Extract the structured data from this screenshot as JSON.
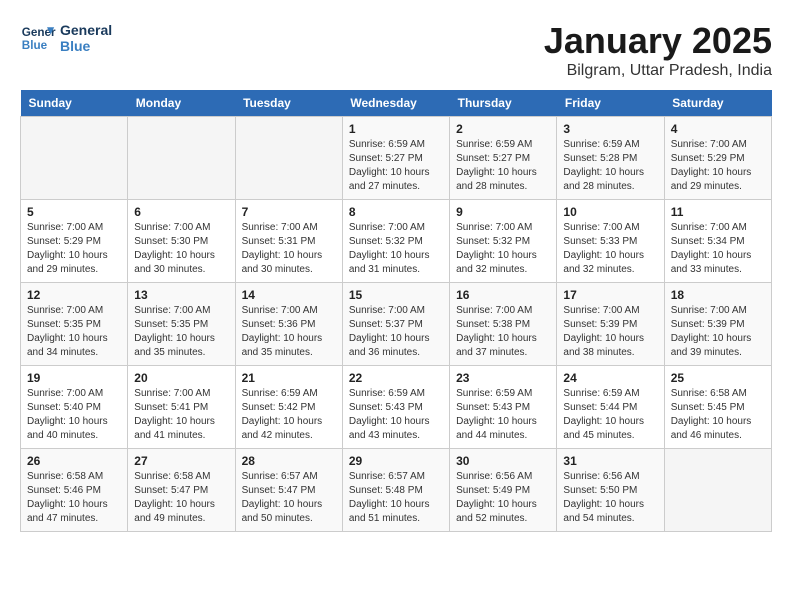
{
  "logo": {
    "line1": "General",
    "line2": "Blue"
  },
  "title": "January 2025",
  "subtitle": "Bilgram, Uttar Pradesh, India",
  "weekdays": [
    "Sunday",
    "Monday",
    "Tuesday",
    "Wednesday",
    "Thursday",
    "Friday",
    "Saturday"
  ],
  "weeks": [
    [
      {
        "day": "",
        "info": ""
      },
      {
        "day": "",
        "info": ""
      },
      {
        "day": "",
        "info": ""
      },
      {
        "day": "1",
        "info": "Sunrise: 6:59 AM\nSunset: 5:27 PM\nDaylight: 10 hours\nand 27 minutes."
      },
      {
        "day": "2",
        "info": "Sunrise: 6:59 AM\nSunset: 5:27 PM\nDaylight: 10 hours\nand 28 minutes."
      },
      {
        "day": "3",
        "info": "Sunrise: 6:59 AM\nSunset: 5:28 PM\nDaylight: 10 hours\nand 28 minutes."
      },
      {
        "day": "4",
        "info": "Sunrise: 7:00 AM\nSunset: 5:29 PM\nDaylight: 10 hours\nand 29 minutes."
      }
    ],
    [
      {
        "day": "5",
        "info": "Sunrise: 7:00 AM\nSunset: 5:29 PM\nDaylight: 10 hours\nand 29 minutes."
      },
      {
        "day": "6",
        "info": "Sunrise: 7:00 AM\nSunset: 5:30 PM\nDaylight: 10 hours\nand 30 minutes."
      },
      {
        "day": "7",
        "info": "Sunrise: 7:00 AM\nSunset: 5:31 PM\nDaylight: 10 hours\nand 30 minutes."
      },
      {
        "day": "8",
        "info": "Sunrise: 7:00 AM\nSunset: 5:32 PM\nDaylight: 10 hours\nand 31 minutes."
      },
      {
        "day": "9",
        "info": "Sunrise: 7:00 AM\nSunset: 5:32 PM\nDaylight: 10 hours\nand 32 minutes."
      },
      {
        "day": "10",
        "info": "Sunrise: 7:00 AM\nSunset: 5:33 PM\nDaylight: 10 hours\nand 32 minutes."
      },
      {
        "day": "11",
        "info": "Sunrise: 7:00 AM\nSunset: 5:34 PM\nDaylight: 10 hours\nand 33 minutes."
      }
    ],
    [
      {
        "day": "12",
        "info": "Sunrise: 7:00 AM\nSunset: 5:35 PM\nDaylight: 10 hours\nand 34 minutes."
      },
      {
        "day": "13",
        "info": "Sunrise: 7:00 AM\nSunset: 5:35 PM\nDaylight: 10 hours\nand 35 minutes."
      },
      {
        "day": "14",
        "info": "Sunrise: 7:00 AM\nSunset: 5:36 PM\nDaylight: 10 hours\nand 35 minutes."
      },
      {
        "day": "15",
        "info": "Sunrise: 7:00 AM\nSunset: 5:37 PM\nDaylight: 10 hours\nand 36 minutes."
      },
      {
        "day": "16",
        "info": "Sunrise: 7:00 AM\nSunset: 5:38 PM\nDaylight: 10 hours\nand 37 minutes."
      },
      {
        "day": "17",
        "info": "Sunrise: 7:00 AM\nSunset: 5:39 PM\nDaylight: 10 hours\nand 38 minutes."
      },
      {
        "day": "18",
        "info": "Sunrise: 7:00 AM\nSunset: 5:39 PM\nDaylight: 10 hours\nand 39 minutes."
      }
    ],
    [
      {
        "day": "19",
        "info": "Sunrise: 7:00 AM\nSunset: 5:40 PM\nDaylight: 10 hours\nand 40 minutes."
      },
      {
        "day": "20",
        "info": "Sunrise: 7:00 AM\nSunset: 5:41 PM\nDaylight: 10 hours\nand 41 minutes."
      },
      {
        "day": "21",
        "info": "Sunrise: 6:59 AM\nSunset: 5:42 PM\nDaylight: 10 hours\nand 42 minutes."
      },
      {
        "day": "22",
        "info": "Sunrise: 6:59 AM\nSunset: 5:43 PM\nDaylight: 10 hours\nand 43 minutes."
      },
      {
        "day": "23",
        "info": "Sunrise: 6:59 AM\nSunset: 5:43 PM\nDaylight: 10 hours\nand 44 minutes."
      },
      {
        "day": "24",
        "info": "Sunrise: 6:59 AM\nSunset: 5:44 PM\nDaylight: 10 hours\nand 45 minutes."
      },
      {
        "day": "25",
        "info": "Sunrise: 6:58 AM\nSunset: 5:45 PM\nDaylight: 10 hours\nand 46 minutes."
      }
    ],
    [
      {
        "day": "26",
        "info": "Sunrise: 6:58 AM\nSunset: 5:46 PM\nDaylight: 10 hours\nand 47 minutes."
      },
      {
        "day": "27",
        "info": "Sunrise: 6:58 AM\nSunset: 5:47 PM\nDaylight: 10 hours\nand 49 minutes."
      },
      {
        "day": "28",
        "info": "Sunrise: 6:57 AM\nSunset: 5:47 PM\nDaylight: 10 hours\nand 50 minutes."
      },
      {
        "day": "29",
        "info": "Sunrise: 6:57 AM\nSunset: 5:48 PM\nDaylight: 10 hours\nand 51 minutes."
      },
      {
        "day": "30",
        "info": "Sunrise: 6:56 AM\nSunset: 5:49 PM\nDaylight: 10 hours\nand 52 minutes."
      },
      {
        "day": "31",
        "info": "Sunrise: 6:56 AM\nSunset: 5:50 PM\nDaylight: 10 hours\nand 54 minutes."
      },
      {
        "day": "",
        "info": ""
      }
    ]
  ]
}
